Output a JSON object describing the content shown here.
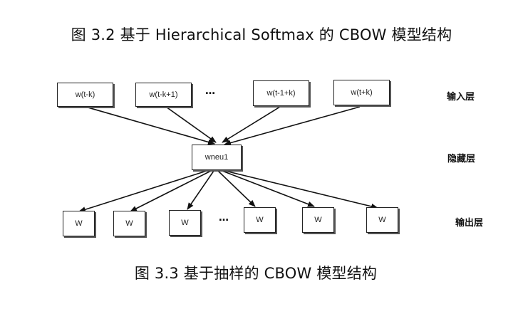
{
  "captions": {
    "top": "图 3.2 基于 Hierarchical Softmax 的 CBOW 模型结构",
    "bottom": "图 3.3 基于抽样的 CBOW 模型结构"
  },
  "layer_labels": {
    "input": "输入层",
    "hidden": "隐藏层",
    "output": "输出层"
  },
  "input_nodes": [
    "w(t-k)",
    "w(t-k+1)",
    "w(t-1+k)",
    "w(t+k)"
  ],
  "hidden_node": "wneu1",
  "output_nodes": [
    "W",
    "W",
    "W",
    "W",
    "W",
    "W"
  ],
  "ellipsis": "…"
}
